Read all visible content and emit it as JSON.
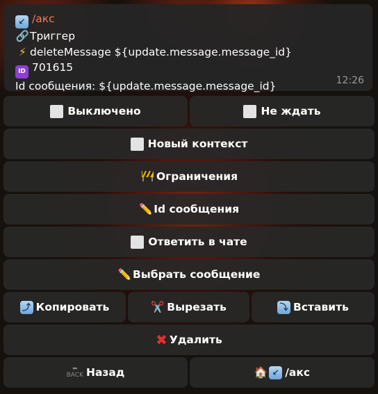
{
  "message": {
    "title": "/акс",
    "trigger": "Триггер",
    "action": "deleteMessage ${update.message.message_id}",
    "id_value": "701615",
    "id_line": "Id сообщения: ${update.message.message_id}",
    "time": "12:26"
  },
  "buttons": {
    "disabled": "Выключено",
    "no_wait": "Не ждать",
    "new_context": "Новый контекст",
    "restrictions": "Ограничения",
    "message_id": "Id сообщения",
    "reply_in_chat": "Ответить в чате",
    "choose_message": "Выбрать сообщение",
    "copy": "Копировать",
    "cut": "Вырезать",
    "paste": "Вставить",
    "delete": "Удалить",
    "back": "Назад",
    "home_path": "/акс"
  },
  "icons": {
    "title": "arrow-down-left-icon",
    "trigger": "link-icon",
    "action": "lightning-icon",
    "id": "id-icon",
    "checkbox": "white-square-icon",
    "restrictions": "construction-icon",
    "edit": "pencil-icon",
    "copy": "arrow-up-icon",
    "cut": "scissors-icon",
    "paste": "arrow-down-icon",
    "delete": "cross-icon",
    "back": "back-arrow-icon",
    "home": "house-icon"
  },
  "colors": {
    "accent": "#f07c54",
    "bubble": "#252525",
    "button": "#282828"
  }
}
